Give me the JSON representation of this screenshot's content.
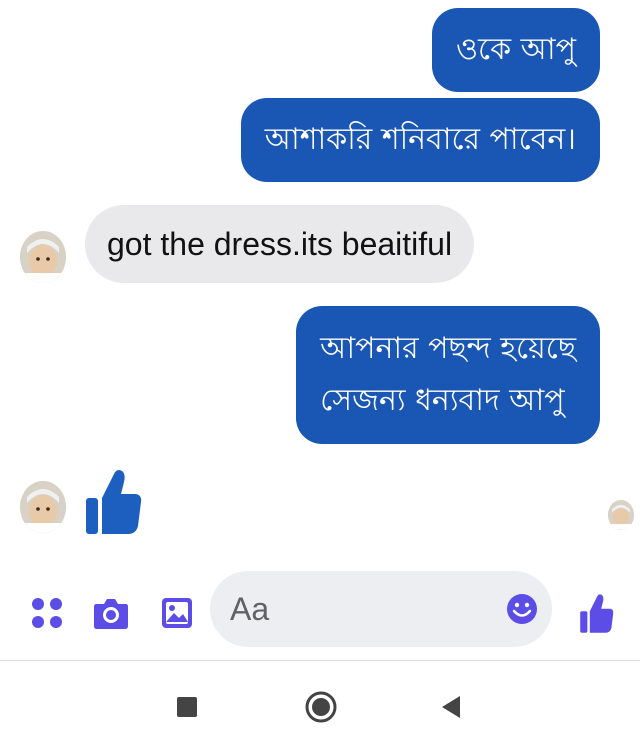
{
  "messages": [
    {
      "direction": "outgoing",
      "text": "ওকে আপু"
    },
    {
      "direction": "outgoing",
      "text": "আশাকরি শনিবারে পাবেন।"
    },
    {
      "direction": "incoming",
      "text": "got the dress.its beaitiful"
    },
    {
      "direction": "outgoing",
      "lines": [
        "আপনার পছন্দ হয়েছে",
        "সেজন্য ধন্যবাদ আপু"
      ]
    },
    {
      "direction": "incoming",
      "type": "like-sticker"
    }
  ],
  "composer": {
    "placeholder": "Aa",
    "icons": [
      "menu-dots-icon",
      "camera-icon",
      "gallery-icon",
      "emoji-icon",
      "like-icon"
    ]
  },
  "navbar": {
    "icons": [
      "recent-apps-icon",
      "home-icon",
      "back-icon"
    ]
  },
  "colors": {
    "outgoing_bubble": "#1a56b4",
    "incoming_bubble": "#e9e9eb",
    "accent": "#5b4de6",
    "like": "#1c5fbf"
  }
}
